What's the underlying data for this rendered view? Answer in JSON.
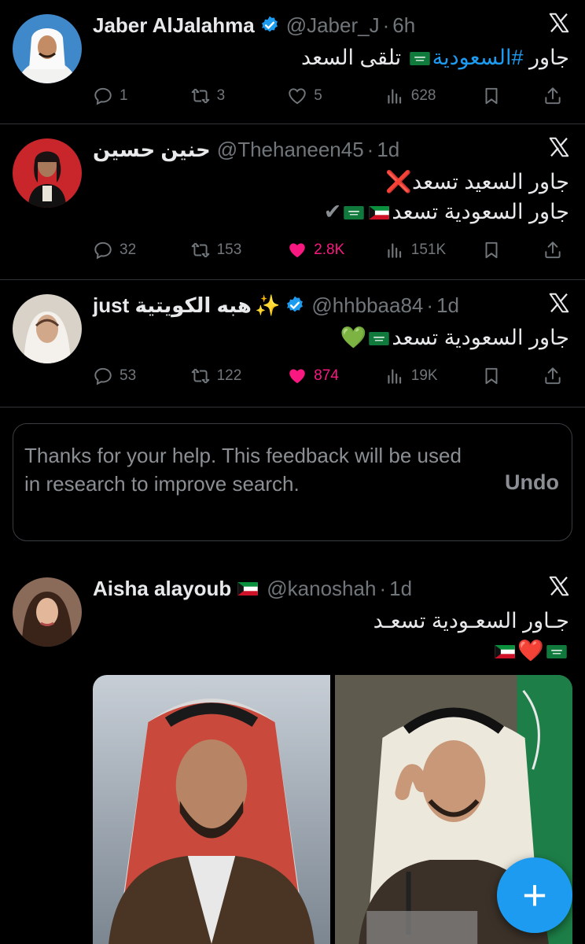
{
  "tweets": [
    {
      "name": "Jaber AlJalahma",
      "handle": "@Jaber_J",
      "time": "6h",
      "verified": true,
      "text_before": "جاور ",
      "hashtag": "#السعودية",
      "text_after": " تلقى السعد",
      "replies": "1",
      "retweets": "3",
      "likes": "5",
      "views": "628"
    },
    {
      "name": "حنين حسين",
      "handle": "@Thehaneen45",
      "time": "1d",
      "line1": "جاور السعيد تسعد",
      "line1_emoji": "❌",
      "line2": "جاور السعودية تسعد",
      "line2_emoji": "✔",
      "replies": "32",
      "retweets": "153",
      "likes": "2.8K",
      "views": "151K"
    },
    {
      "name": "just هبه الكويتية",
      "name_emoji": "✨",
      "handle": "@hhbbaa84",
      "time": "1d",
      "verified": true,
      "text": "جاور السعودية تسعد",
      "emoji": "💚",
      "replies": "53",
      "retweets": "122",
      "likes": "874",
      "views": "19K"
    },
    {
      "name": "Aisha alayoub",
      "handle": "@kanoshah",
      "time": "1d",
      "line1": "جـاور السعـودية تسعـد",
      "heart": "❤️"
    }
  ],
  "feedback": {
    "message": "Thanks for your help. This feedback will be used in research to improve search.",
    "undo": "Undo"
  },
  "dot": "·",
  "fab_label": "+",
  "colors": {
    "accent": "#1d9bf0",
    "like": "#f91880",
    "muted": "#71767b",
    "background": "#000000"
  }
}
